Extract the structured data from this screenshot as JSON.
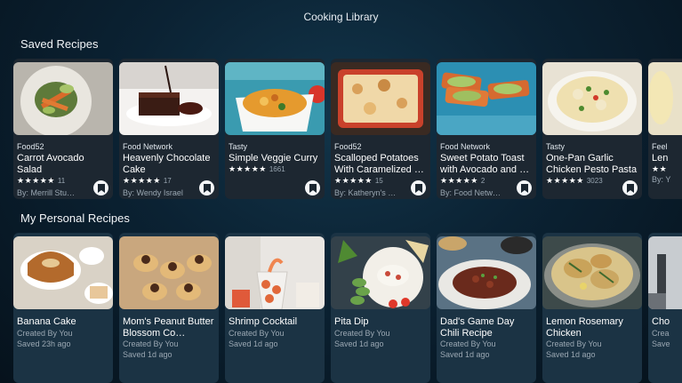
{
  "app": {
    "title": "Cooking Library"
  },
  "saved": {
    "title": "Saved Recipes",
    "cards": [
      {
        "source": "Food52",
        "title": "Carrot Avocado Salad",
        "rating": "★★★★★",
        "count": "11",
        "author": "By: Merrill Stu…"
      },
      {
        "source": "Food Network",
        "title": "Heavenly Chocolate Cake",
        "rating": "★★★★★",
        "count": "17",
        "author": "By: Wendy Israel"
      },
      {
        "source": "Tasty",
        "title": "Simple Veggie Curry",
        "rating": "★★★★★",
        "count": "1661",
        "author": ""
      },
      {
        "source": "Food52",
        "title": "Scalloped Potatoes With Caramelized …",
        "rating": "★★★★★",
        "count": "15",
        "author": "By: Katheryn's …"
      },
      {
        "source": "Food Network",
        "title": "Sweet Potato Toast with Avocado and …",
        "rating": "★★★★★",
        "count": "2",
        "author": "By: Food Netw…"
      },
      {
        "source": "Tasty",
        "title": "One-Pan Garlic Chicken Pesto Pasta",
        "rating": "★★★★★",
        "count": "3023",
        "author": ""
      },
      {
        "source": "Feel",
        "title": "Len",
        "rating": "★★",
        "count": "",
        "author": "By: Y"
      }
    ]
  },
  "personal": {
    "title": "My Personal Recipes",
    "cards": [
      {
        "title": "Banana Cake",
        "created": "Created By You",
        "saved": "Saved 23h ago"
      },
      {
        "title": "Mom's Peanut Butter Blossom Co…",
        "created": "Created By You",
        "saved": "Saved 1d ago"
      },
      {
        "title": "Shrimp Cocktail",
        "created": "Created By You",
        "saved": "Saved 1d ago"
      },
      {
        "title": "Pita Dip",
        "created": "Created By You",
        "saved": "Saved 1d ago"
      },
      {
        "title": "Dad's Game Day Chili Recipe",
        "created": "Created By You",
        "saved": "Saved 1d ago"
      },
      {
        "title": "Lemon Rosemary Chicken",
        "created": "Created By You",
        "saved": "Saved 1d ago"
      },
      {
        "title": "Cho",
        "created": "Crea",
        "saved": "Save"
      }
    ]
  },
  "icons": {
    "bookmark": "bookmark-icon",
    "star": "star-icon"
  }
}
